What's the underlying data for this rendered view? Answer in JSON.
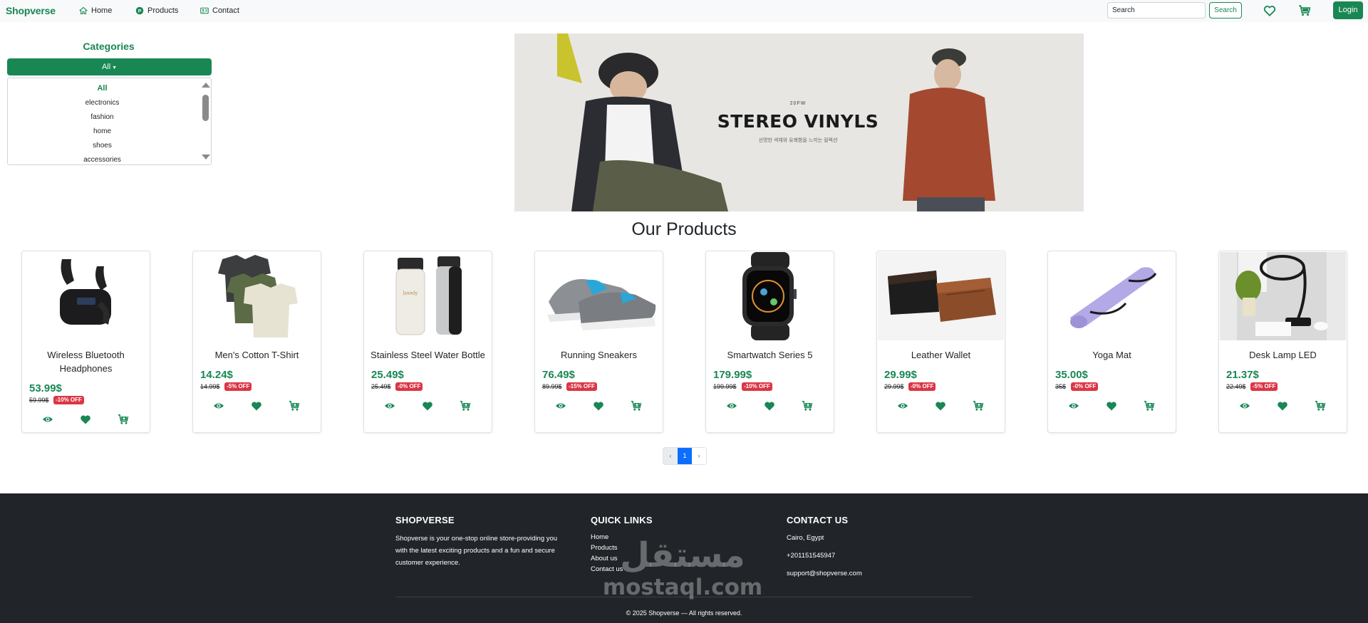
{
  "navbar": {
    "brand": "Shopverse",
    "links": [
      {
        "label": "Home",
        "icon": "home-icon"
      },
      {
        "label": "Products",
        "icon": "products-icon"
      },
      {
        "label": "Contact",
        "icon": "contact-icon"
      }
    ],
    "search_placeholder": "Search",
    "search_button": "Search",
    "login_button": "Login"
  },
  "categories": {
    "title": "Categories",
    "selected": "All",
    "items": [
      "All",
      "electronics",
      "fashion",
      "home",
      "shoes",
      "accessories"
    ]
  },
  "banner": {
    "small_text": "20FW",
    "title": "STEREO VINYLS",
    "subtitle": "선명한 색채와 유쾌함을 느끼는 컬렉션"
  },
  "products_section": {
    "title": "Our Products",
    "items": [
      {
        "name": "Wireless Bluetooth Headphones",
        "price": "53.99$",
        "old_price": "59.99$",
        "discount": "-10% OFF"
      },
      {
        "name": "Men's Cotton T-Shirt",
        "price": "14.24$",
        "old_price": "14.99$",
        "discount": "-5% OFF"
      },
      {
        "name": "Stainless Steel Water Bottle",
        "price": "25.49$",
        "old_price": "25.49$",
        "discount": "-0% OFF"
      },
      {
        "name": "Running Sneakers",
        "price": "76.49$",
        "old_price": "89.99$",
        "discount": "-15% OFF"
      },
      {
        "name": "Smartwatch Series 5",
        "price": "179.99$",
        "old_price": "199.99$",
        "discount": "-10% OFF"
      },
      {
        "name": "Leather Wallet",
        "price": "29.99$",
        "old_price": "29.99$",
        "discount": "-0% OFF"
      },
      {
        "name": "Yoga Mat",
        "price": "35.00$",
        "old_price": "35$",
        "discount": "-0% OFF"
      },
      {
        "name": "Desk Lamp LED",
        "price": "21.37$",
        "old_price": "22.49$",
        "discount": "-5% OFF"
      }
    ]
  },
  "pagination": {
    "prev": "‹",
    "current": "1",
    "next": "›"
  },
  "footer": {
    "about_heading": "SHOPVERSE",
    "about_text": "Shopverse is your one-stop online store-providing you with the latest exciting products and a fun and secure customer experience.",
    "links_heading": "QUICK LINKS",
    "links": [
      "Home",
      "Products",
      "About us",
      "Contact us"
    ],
    "contact_heading": "CONTACT US",
    "address": "Cairo, Egypt",
    "phone": "+201151545947",
    "email": "support@shopverse.com",
    "copyright": "© 2025 Shopverse — All rights reserved."
  },
  "watermark": {
    "arabic": "مستقل",
    "latin": "mostaql.com"
  },
  "colors": {
    "brand_green": "#198754",
    "discount_red": "#dc3545",
    "footer_bg": "#212529",
    "page_active": "#0d6efd"
  }
}
